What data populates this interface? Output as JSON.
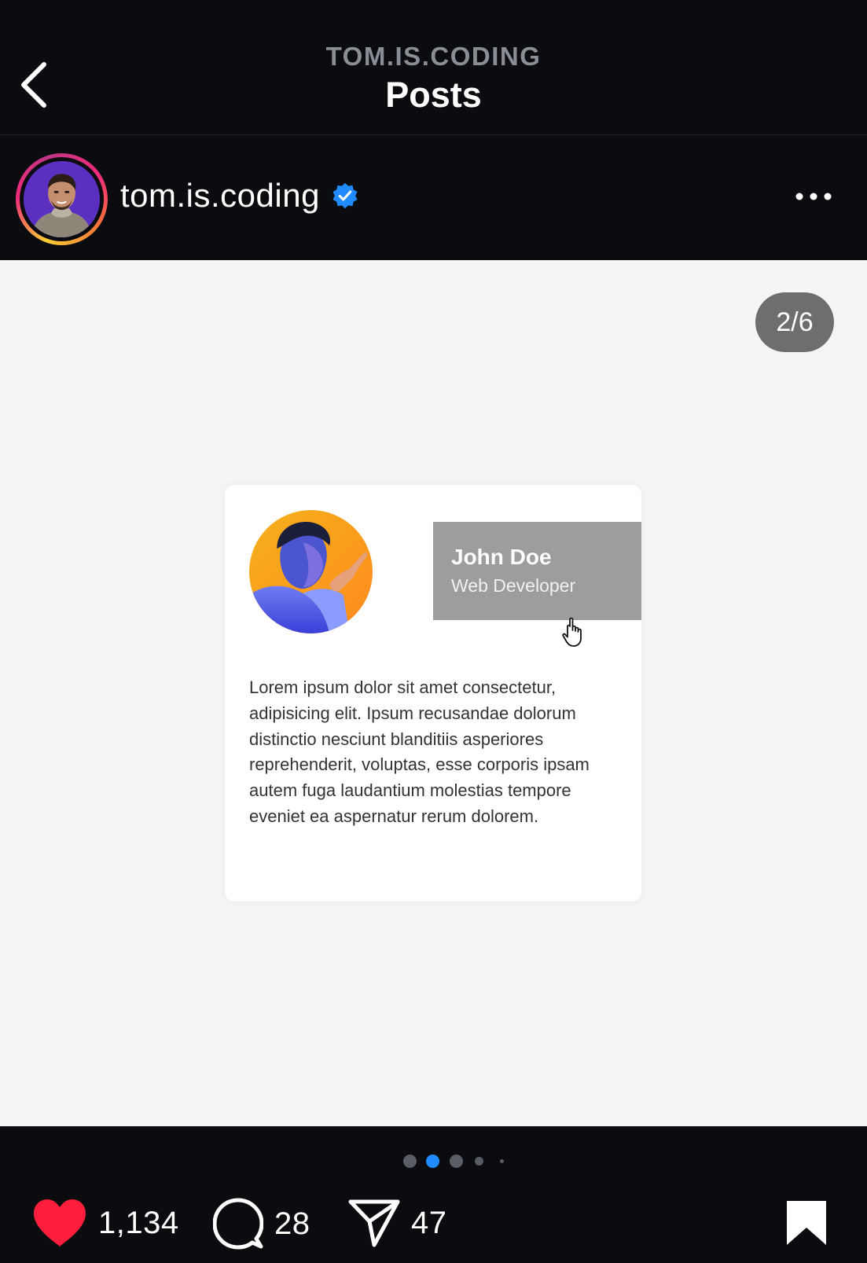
{
  "header": {
    "account_label": "TOM.IS.CODING",
    "title": "Posts",
    "back_icon": "chevron-left-icon"
  },
  "profile": {
    "username": "tom.is.coding",
    "verified": true,
    "verified_color": "#1f8bff",
    "more_icon": "ellipsis-icon"
  },
  "post": {
    "counter": "2/6",
    "card": {
      "name": "John Doe",
      "role": "Web Developer",
      "body": "Lorem ipsum dolor sit amet consectetur, adipisicing elit. Ipsum recusandae dolorum distinctio nesciunt blanditiis asperiores reprehenderit, voluptas, esse corporis ipsam autem fuga laudantium molestias tempore eveniet ea aspernatur rerum dolorem."
    },
    "carousel_active_index": 2
  },
  "actions": {
    "likes": "1,134",
    "comments": "28",
    "shares": "47",
    "like_color": "#ff1f3d",
    "icons": [
      "heart-icon",
      "comment-icon",
      "send-icon",
      "bookmark-icon"
    ]
  }
}
